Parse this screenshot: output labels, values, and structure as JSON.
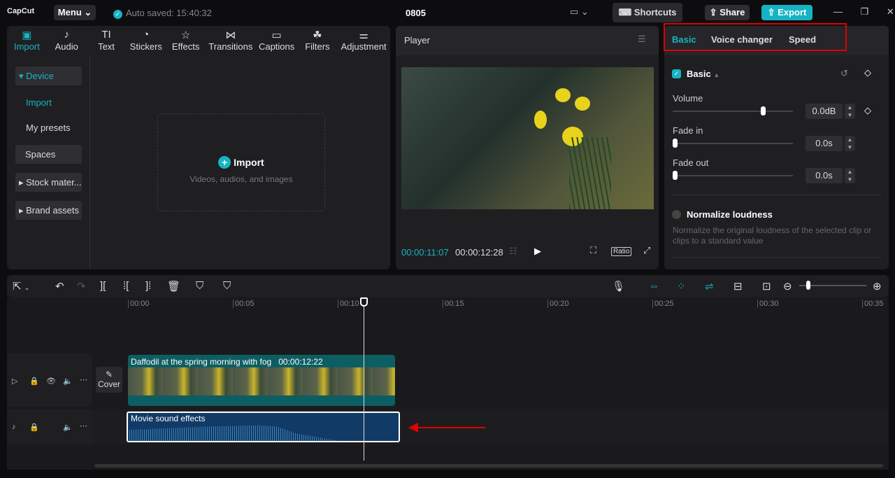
{
  "app": {
    "logo": "CapCut",
    "menu": "Menu",
    "autosave": "Auto saved: 15:40:32",
    "title": "0805",
    "shortcuts": "Shortcuts",
    "share": "Share",
    "export": "Export"
  },
  "media_tabs": [
    {
      "label": "Import",
      "icon": "▣"
    },
    {
      "label": "Audio",
      "icon": "♪"
    },
    {
      "label": "Text",
      "icon": "TI"
    },
    {
      "label": "Stickers",
      "icon": "◔"
    },
    {
      "label": "Effects",
      "icon": "☆"
    },
    {
      "label": "Transitions",
      "icon": "⋈"
    },
    {
      "label": "Captions",
      "icon": "▭"
    },
    {
      "label": "Filters",
      "icon": "☘"
    },
    {
      "label": "Adjustment",
      "icon": "⚌"
    }
  ],
  "sidebar": {
    "device": "▾ Device",
    "import": "Import",
    "presets": "My presets",
    "spaces": "Spaces",
    "stock": "▸ Stock mater...",
    "brand": "▸ Brand assets"
  },
  "import_area": {
    "label": "Import",
    "sub": "Videos, audios, and images"
  },
  "player": {
    "title": "Player",
    "current": "00:00:11:07",
    "total": "00:00:12:28",
    "ratio": "Ratio"
  },
  "right_panel": {
    "tabs": [
      "Basic",
      "Voice changer",
      "Speed"
    ],
    "section": "Basic",
    "volume_label": "Volume",
    "volume": "0.0dB",
    "volume_level": 0.73,
    "fadein_label": "Fade in",
    "fadein": "0.0s",
    "fadeout_label": "Fade out",
    "fadeout": "0.0s",
    "normalize": "Normalize loudness",
    "normalize_desc": "Normalize the original loudness of the selected clip or clips to a standard value"
  },
  "timeline": {
    "ticks": [
      "00:00",
      "00:05",
      "00:10",
      "00:15",
      "00:20",
      "00:25",
      "00:30",
      "00:35"
    ],
    "video_clip": {
      "name": "Daffodil at the spring morning with fog",
      "duration": "00:00:12:22"
    },
    "cover": "Cover",
    "audio_clip": {
      "name": "Movie sound effects"
    }
  },
  "colors": {
    "accent": "#17b3c4",
    "highlight": "#e00000"
  }
}
